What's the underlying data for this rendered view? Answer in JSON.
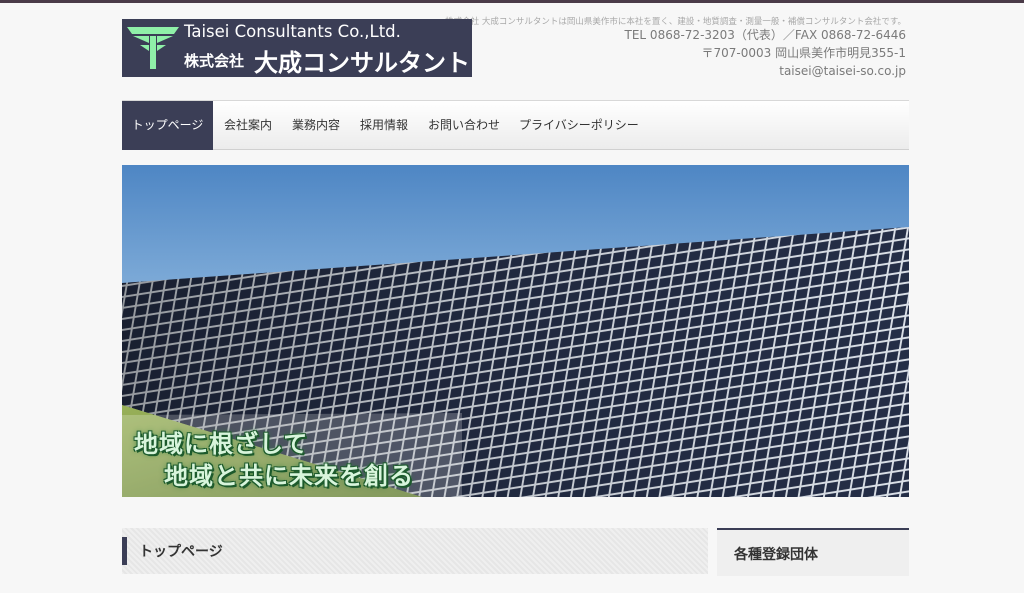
{
  "header": {
    "tagline": "株式会社 大成コンサルタントは岡山県美作市に本社を置く、建設・地質調査・測量一般・補償コンサルタント会社です。",
    "contact": {
      "tel_fax": "TEL 0868-72-3203（代表）／FAX 0868-72-6446",
      "address": "〒707-0003 岡山県美作市明見355-1",
      "email": "taisei@taisei-so.co.jp"
    },
    "logo": {
      "english_name": "Taisei Consultants Co.,Ltd.",
      "company_prefix": "株式会社",
      "company_name": "大成コンサルタント",
      "accent_color": "#8ff0a8"
    }
  },
  "nav": {
    "items": [
      {
        "label": "トップページ",
        "active": true
      },
      {
        "label": "会社案内",
        "active": false
      },
      {
        "label": "業務内容",
        "active": false
      },
      {
        "label": "採用情報",
        "active": false
      },
      {
        "label": "お問い合わせ",
        "active": false
      },
      {
        "label": "プライバシーポリシー",
        "active": false
      }
    ]
  },
  "hero": {
    "line1": "地域に根ざして",
    "line2": "地域と共に未来を創る"
  },
  "main": {
    "section_title": "トップページ"
  },
  "sidebar": {
    "title": "各種登録団体"
  },
  "colors": {
    "brand_navy": "#3b3e56",
    "page_bg": "#f7f7f7"
  }
}
